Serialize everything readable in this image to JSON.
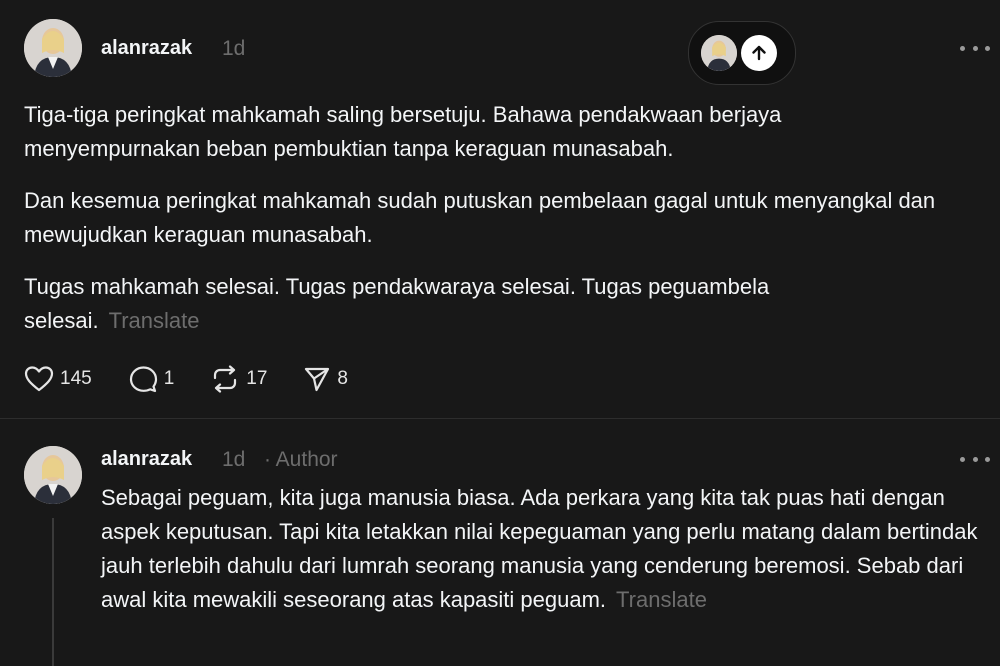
{
  "post": {
    "username": "alanrazak",
    "time": "1d",
    "paragraphs": [
      "Tiga-tiga peringkat mahkamah saling bersetuju. Bahawa pendakwaan berjaya menyempurnakan beban pembuktian tanpa keraguan munasabah.",
      "Dan kesemua peringkat mahkamah sudah putuskan pembelaan gagal untuk menyangkal dan mewujudkan keraguan munasabah.",
      "Tugas mahkamah selesai. Tugas pendakwaraya selesai. Tugas peguambela selesai."
    ],
    "translate": "Translate",
    "likes": "145",
    "replies": "1",
    "reposts": "17",
    "shares": "8"
  },
  "reply": {
    "username": "alanrazak",
    "time": "1d",
    "author_tag": "· Author",
    "text": "Sebagai peguam, kita juga manusia biasa. Ada perkara yang kita tak puas hati dengan aspek keputusan. Tapi kita letakkan nilai kepeguaman yang perlu matang dalam bertindak jauh terlebih dahulu dari lumrah seorang manusia yang cenderung beremosi. Sebab dari awal kita mewakili seseorang atas kapasiti peguam.",
    "translate": "Translate"
  },
  "colors": {
    "background": "#181818",
    "text": "#f3f5f7",
    "muted": "#6d6d6d"
  },
  "icons": [
    "avatar",
    "scroll-to-top-icon",
    "more-icon",
    "heart-icon",
    "comment-icon",
    "repost-icon",
    "share-icon"
  ]
}
